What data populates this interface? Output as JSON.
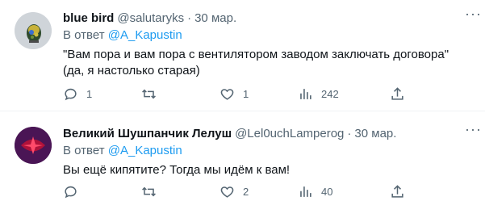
{
  "tweets": [
    {
      "name": "blue bird",
      "handle": "@salutaryks",
      "separator": "·",
      "date": "30 мар.",
      "reply_prefix": "В ответ",
      "reply_mention": "@A_Kapustin",
      "text": "\"Вам пора и вам пора с вентилятором заводом заключать договора\"\n(да, я настолько старая)",
      "counts": {
        "replies": "1",
        "retweets": "",
        "likes": "1",
        "views": "242"
      },
      "avatar_icon": "bird-photo-avatar"
    },
    {
      "name": "Великий Шушпанчик Лелуш",
      "handle": "@Lel0uchLamperog",
      "separator": "·",
      "date": "30 мар.",
      "reply_prefix": "В ответ",
      "reply_mention": "@A_Kapustin",
      "text": "Вы ещё кипятите? Тогда мы идём к вам!",
      "counts": {
        "replies": "",
        "retweets": "",
        "likes": "2",
        "views": "40"
      },
      "avatar_icon": "geass-sigil-avatar"
    }
  ],
  "colors": {
    "accent": "#1d9bf0",
    "muted": "#536471",
    "text": "#0f1419",
    "divider": "#eff3f4"
  },
  "icons": [
    "more-icon",
    "reply-icon",
    "retweet-icon",
    "like-icon",
    "views-icon",
    "share-icon"
  ]
}
